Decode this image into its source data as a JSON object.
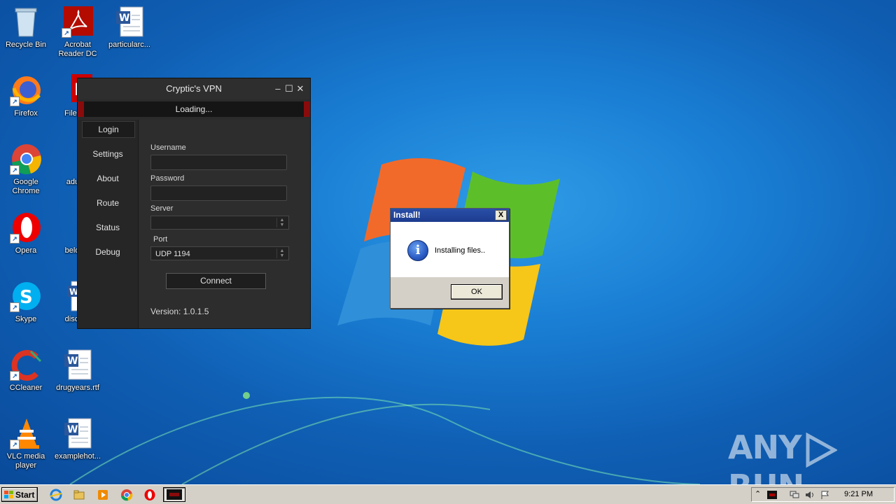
{
  "desktop": {
    "icons": [
      {
        "label": "Recycle Bin",
        "icon": "recycle-bin-icon"
      },
      {
        "label": "Acrobat Reader DC",
        "icon": "acrobat-icon"
      },
      {
        "label": "particularc...",
        "icon": "word-doc-icon"
      },
      {
        "label": "Firefox",
        "icon": "firefox-icon"
      },
      {
        "label": "FileZilla",
        "icon": "filezilla-icon"
      },
      {
        "label": "Google Chrome",
        "icon": "chrome-icon"
      },
      {
        "label": "adultle",
        "icon": "document-icon"
      },
      {
        "label": "Opera",
        "icon": "opera-icon"
      },
      {
        "label": "beloww",
        "icon": "document-icon"
      },
      {
        "label": "Skype",
        "icon": "skype-icon"
      },
      {
        "label": "discuss",
        "icon": "word-doc-icon"
      },
      {
        "label": "CCleaner",
        "icon": "ccleaner-icon"
      },
      {
        "label": "drugyears.rtf",
        "icon": "word-doc-icon"
      },
      {
        "label": "VLC media player",
        "icon": "vlc-icon"
      },
      {
        "label": "examplehot...",
        "icon": "word-doc-icon"
      }
    ]
  },
  "vpn": {
    "title": "Cryptic's VPN",
    "status": "Loading...",
    "nav": [
      "Login",
      "Settings",
      "About",
      "Route",
      "Status",
      "Debug"
    ],
    "username_label": "Username",
    "password_label": "Password",
    "server_label": "Server",
    "server_value": "",
    "port_label": "Port",
    "port_value": "UDP 1194",
    "connect_label": "Connect",
    "version": "Version: 1.0.1.5"
  },
  "dialog": {
    "title": "Install!",
    "close": "X",
    "message": "Installing files..",
    "ok_label": "OK"
  },
  "watermark": {
    "left": "ANY",
    "right": "RUN"
  },
  "taskbar": {
    "start_label": "Start",
    "clock": "9:21 PM"
  },
  "colors": {
    "desktop_blue": "#1a7fd4",
    "vpn_bg": "#2b2b2b",
    "loading_red": "#8a0b0b",
    "dialog_title": "#2a4fa8"
  }
}
